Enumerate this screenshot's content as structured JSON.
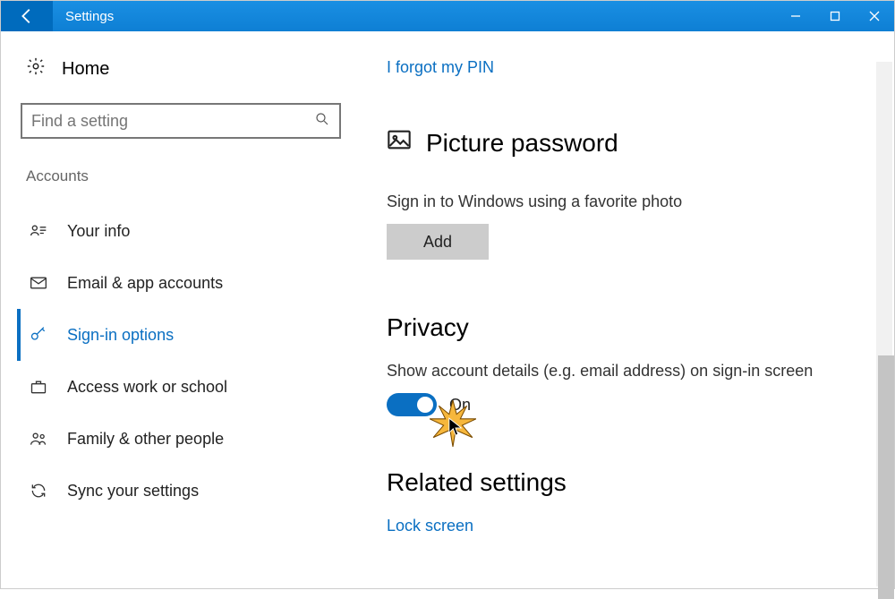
{
  "titlebar": {
    "title": "Settings"
  },
  "sidebar": {
    "home_label": "Home",
    "search_placeholder": "Find a setting",
    "category_label": "Accounts",
    "items": [
      {
        "label": "Your info"
      },
      {
        "label": "Email & app accounts"
      },
      {
        "label": "Sign-in options"
      },
      {
        "label": "Access work or school"
      },
      {
        "label": "Family & other people"
      },
      {
        "label": "Sync your settings"
      }
    ]
  },
  "content": {
    "forgot_pin_link": "I forgot my PIN",
    "picture_password_title": "Picture password",
    "picture_password_desc": "Sign in to Windows using a favorite photo",
    "add_button": "Add",
    "privacy_title": "Privacy",
    "privacy_desc": "Show account details (e.g. email address) on sign-in screen",
    "toggle_state_label": "On",
    "related_title": "Related settings",
    "lock_screen_link": "Lock screen"
  }
}
